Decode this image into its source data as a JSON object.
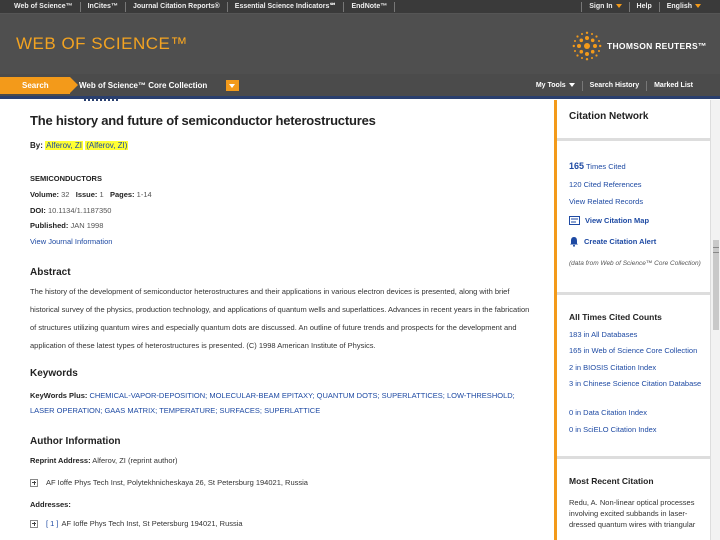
{
  "topnav": {
    "products": [
      "Web of Science™",
      "InCites™",
      "Journal Citation Reports®",
      "Essential Science Indicators℠",
      "EndNote™"
    ],
    "sign_in": "Sign In",
    "help": "Help",
    "language": "English"
  },
  "header": {
    "logo": "WEB OF SCIENCE™",
    "publisher": "THOMSON REUTERS™"
  },
  "tabs": {
    "search": "Search",
    "collection": "Web of Science™ Core Collection",
    "my_tools": "My Tools",
    "search_history": "Search History",
    "marked_list": "Marked List"
  },
  "record": {
    "title": "The history and future of semiconductor heterostructures",
    "by_label": "By:",
    "author1": "Alferov, ZI",
    "author2": "(Alferov, ZI)",
    "journal": "SEMICONDUCTORS",
    "volume_label": "Volume:",
    "volume": "32",
    "issue_label": "Issue:",
    "issue": "1",
    "pages_label": "Pages:",
    "pages": "1-14",
    "doi_label": "DOI:",
    "doi": "10.1134/1.1187350",
    "published_label": "Published:",
    "published": "JAN 1998",
    "view_journal": "View Journal Information",
    "abstract_heading": "Abstract",
    "abstract": "The history of the development of semiconductor heterostructures and their applications in various electron devices is presented, along with brief historical survey of the physics, production technology, and applications of quantum wells and superlattices. Advances in recent years in the fabrication of structures utilizing quantum wires and especially quantum dots are discussed. An outline of future trends and prospects for the development and application of these latest types of heterostructures is presented. (C) 1998 American Institute of Physics.",
    "keywords_heading": "Keywords",
    "keywords_label": "KeyWords Plus:",
    "keywords": "CHEMICAL-VAPOR-DEPOSITION; MOLECULAR-BEAM EPITAXY; QUANTUM DOTS; SUPERLATTICES; LOW-THRESHOLD; LASER OPERATION; GAAS MATRIX; TEMPERATURE; SURFACES; SUPERLATTICE",
    "author_info_heading": "Author Information",
    "reprint_label": "Reprint Address:",
    "reprint_value": "Alferov, ZI (reprint author)",
    "reprint_address": "AF Ioffe Phys Tech Inst, Polytekhnicheskaya 26, St Petersburg 194021, Russia",
    "addresses_label": "Addresses:",
    "address_index": "[ 1 ]",
    "address_1": "AF Ioffe Phys Tech Inst, St Petersburg 194021, Russia"
  },
  "sidebar": {
    "citation_network": "Citation Network",
    "times_cited_num": "165",
    "times_cited_label": "Times Cited",
    "cited_refs": "120 Cited References",
    "related": "View Related Records",
    "view_map": "View Citation Map",
    "create_alert": "Create Citation Alert",
    "note": "(data from Web of Science™ Core Collection)",
    "all_times_heading": "All Times Cited Counts",
    "count_all": "183 in All Databases",
    "count_wos": "165 in Web of Science Core Collection",
    "count_biosis": "2 in BIOSIS Citation Index",
    "count_chinese": "3 in Chinese Science Citation Database",
    "count_data": "0 in Data Citation Index",
    "count_scielo": "0 in SciELO Citation Index",
    "recent_heading": "Most Recent Citation",
    "recent_text": "Redu, A. Non-linear optical processes involving excited subbands in laser-dressed quantum wires with triangular"
  }
}
